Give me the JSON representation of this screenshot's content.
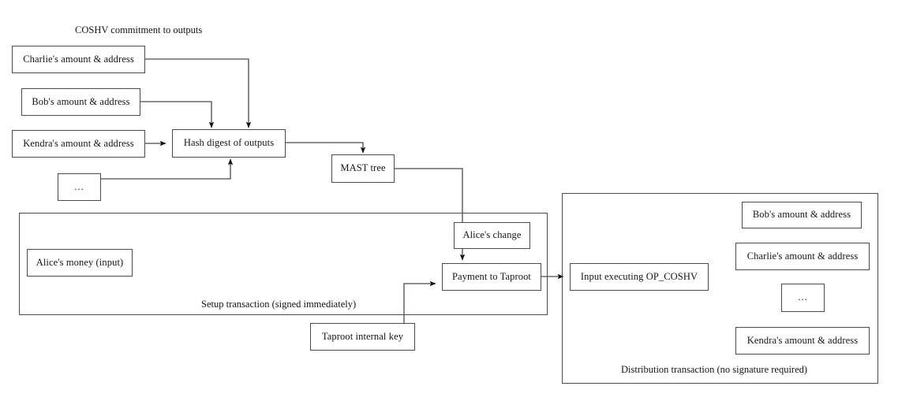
{
  "diagram": {
    "title": "COSHV commitment to outputs",
    "nodes": {
      "charlie_input": "Charlie's amount & address",
      "bob_input": "Bob's amount & address",
      "kendra_input": "Kendra's amount & address",
      "ellipsis_input": "...",
      "hash_digest": "Hash digest of outputs",
      "mast_tree": "MAST tree",
      "alice_money": "Alice's money (input)",
      "alice_change": "Alice's change",
      "payment_taproot": "Payment to Taproot",
      "taproot_internal_key": "Taproot internal key",
      "input_executing": "Input executing OP_COSHV",
      "bob_output": "Bob's amount & address",
      "charlie_output": "Charlie's amount & address",
      "ellipsis_output": "...",
      "kendra_output": "Kendra's amount & address"
    },
    "groups": {
      "setup_transaction": "Setup transaction (signed immediately)",
      "distribution_transaction": "Distribution transaction (no signature required)"
    },
    "colors": {
      "stroke": "#4a4a4a",
      "text": "#151515",
      "background": "#ffffff",
      "arrowhead": "#111111"
    }
  }
}
